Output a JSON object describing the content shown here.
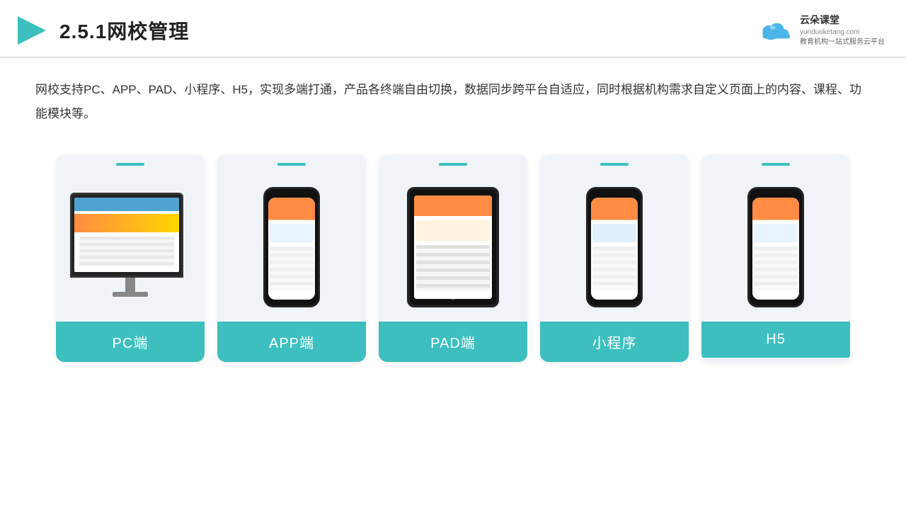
{
  "header": {
    "title": "2.5.1网校管理",
    "logo": {
      "name": "云朵课堂",
      "url": "yunduoketang.com",
      "tagline": "教育机构一站式服务云平台"
    }
  },
  "description": "网校支持PC、APP、PAD、小程序、H5，实现多端打通，产品各终端自由切换，数据同步跨平台自适应，同时根据机构需求自定义页面上的内容、课程、功能模块等。",
  "cards": [
    {
      "id": "pc",
      "label": "PC端"
    },
    {
      "id": "app",
      "label": "APP端"
    },
    {
      "id": "pad",
      "label": "PAD端"
    },
    {
      "id": "miniprogram",
      "label": "小程序"
    },
    {
      "id": "h5",
      "label": "H5"
    }
  ],
  "colors": {
    "teal": "#3dbfbf",
    "accent": "#ff8c42"
  }
}
